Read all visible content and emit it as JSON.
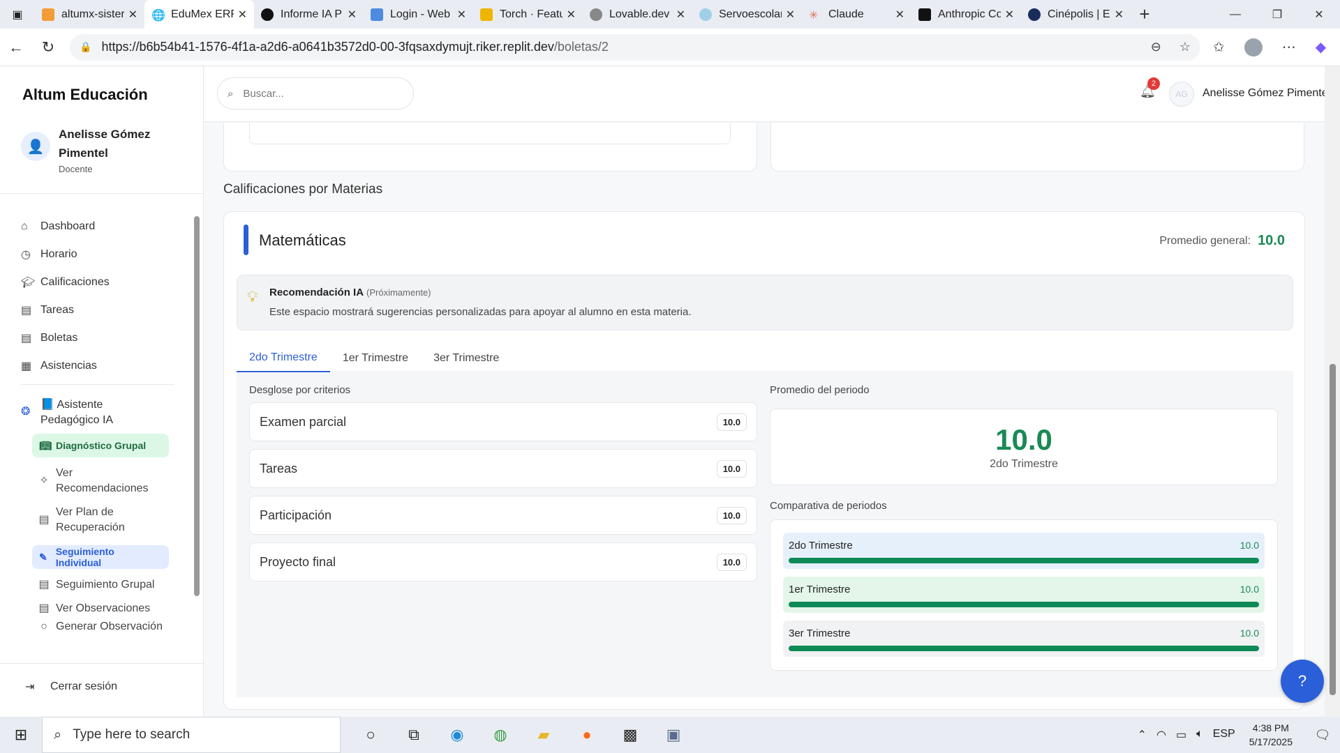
{
  "browser": {
    "tabs": [
      {
        "title": "altumx-sister",
        "active": false
      },
      {
        "title": "EduMex ERP",
        "active": true
      },
      {
        "title": "Informe IA P",
        "active": false
      },
      {
        "title": "Login - Web",
        "active": false
      },
      {
        "title": "Torch · Featu",
        "active": false
      },
      {
        "title": "Lovable.dev",
        "active": false
      },
      {
        "title": "Servoescolar",
        "active": false
      },
      {
        "title": "Claude",
        "active": false
      },
      {
        "title": "Anthropic Co",
        "active": false
      },
      {
        "title": "Cinépolis | E",
        "active": false
      }
    ],
    "url_host": "https://b6b54b41-1576-4f1a-a2d6-a0641b3572d0-00-3fqsaxdymujt.riker.replit.dev",
    "url_path": "/boletas/2"
  },
  "sidebar": {
    "brand": "Altum Educación",
    "user_name": "Anelisse Gómez Pimentel",
    "user_role": "Docente",
    "items": [
      {
        "label": "Dashboard",
        "icon": "home-icon"
      },
      {
        "label": "Horario",
        "icon": "clock-icon"
      },
      {
        "label": "Calificaciones",
        "icon": "graduation-cap-icon"
      },
      {
        "label": "Tareas",
        "icon": "document-icon"
      },
      {
        "label": "Boletas",
        "icon": "document-icon"
      },
      {
        "label": "Asistencias",
        "icon": "calendar-icon"
      }
    ],
    "ai_assistant": "📘 Asistente Pedagógico IA",
    "group_diag": "Diagnóstico Grupal",
    "ver_recomendaciones": "Ver Recomendaciones",
    "ver_plan": "Ver Plan de Recuperación",
    "individual": "Seguimiento Individual",
    "seguimiento_grupal": "Seguimiento Grupal",
    "ver_observaciones": "Ver Observaciones",
    "generar_observacion": "Generar Observación",
    "logout": "Cerrar sesión"
  },
  "topbar": {
    "search_placeholder": "Buscar...",
    "notifications": "2",
    "avatar_initials": "AG",
    "user_name": "Anelisse Gómez Pimentel"
  },
  "main": {
    "section_title": "Calificaciones por Materias",
    "subject": "Matemáticas",
    "avg_label": "Promedio general:",
    "avg_value": "10.0",
    "ai_title": "Recomendación IA",
    "ai_soon": "(Próximamente)",
    "ai_desc": "Este espacio mostrará sugerencias personalizadas para apoyar al alumno en esta materia.",
    "tabs": [
      "2do Trimestre",
      "1er Trimestre",
      "3er Trimestre"
    ],
    "breakdown_title": "Desglose por criterios",
    "criteria": [
      {
        "name": "Examen parcial",
        "score": "10.0"
      },
      {
        "name": "Tareas",
        "score": "10.0"
      },
      {
        "name": "Participación",
        "score": "10.0"
      },
      {
        "name": "Proyecto final",
        "score": "10.0"
      }
    ],
    "period_title": "Promedio del periodo",
    "period_value": "10.0",
    "period_label": "2do Trimestre",
    "compare_title": "Comparativa de periodos",
    "compare": [
      {
        "name": "2do Trimestre",
        "value": "10.0",
        "fraction": 1.0,
        "bg": "#e6f0fb"
      },
      {
        "name": "1er Trimestre",
        "value": "10.0",
        "fraction": 1.0,
        "bg": "#e3f6e9"
      },
      {
        "name": "3er Trimestre",
        "value": "10.0",
        "fraction": 1.0,
        "bg": "#f1f2f4"
      }
    ]
  },
  "taskbar": {
    "search_placeholder": "Type here to search",
    "lang": "ESP",
    "time": "4:38 PM",
    "date": "5/17/2025"
  }
}
